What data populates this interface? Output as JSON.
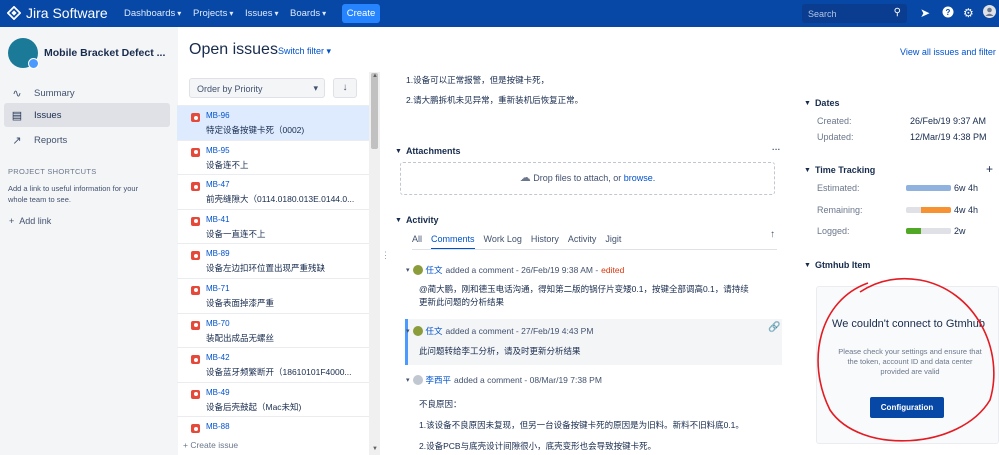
{
  "topbar": {
    "app_name": "Jira Software",
    "nav": [
      {
        "label": "Dashboards"
      },
      {
        "label": "Projects"
      },
      {
        "label": "Issues"
      },
      {
        "label": "Boards"
      }
    ],
    "create_label": "Create",
    "search_placeholder": "Search"
  },
  "sidebar": {
    "project_name": "Mobile Bracket Defect ...",
    "items": [
      {
        "label": "Summary",
        "icon": "pulse-icon"
      },
      {
        "label": "Issues",
        "icon": "issues-icon"
      },
      {
        "label": "Reports",
        "icon": "chart-icon"
      }
    ],
    "shortcuts_title": "PROJECT SHORTCUTS",
    "shortcuts_text": "Add a link to useful information for your whole team to see.",
    "add_link_label": "Add link"
  },
  "header": {
    "title": "Open issues",
    "switch_filter": "Switch filter",
    "view_all": "View all issues and filter"
  },
  "list": {
    "order_label": "Order by Priority",
    "issues": [
      {
        "key": "MB-96",
        "summary": "特定设备按键卡死（0002)"
      },
      {
        "key": "MB-95",
        "summary": "设备连不上"
      },
      {
        "key": "MB-47",
        "summary": "前壳缝隙大（0114.0180.013E.0144.0..."
      },
      {
        "key": "MB-41",
        "summary": "设备一直连不上"
      },
      {
        "key": "MB-89",
        "summary": "设备左边扣环位置出现严重残缺"
      },
      {
        "key": "MB-71",
        "summary": "设备表面掉漆严重"
      },
      {
        "key": "MB-70",
        "summary": "装配出成品无螺丝"
      },
      {
        "key": "MB-42",
        "summary": "设备蓝牙频繁断开（18610101F4000..."
      },
      {
        "key": "MB-49",
        "summary": "设备后壳鼓起（Mac未知)"
      },
      {
        "key": "MB-88",
        "summary": ""
      }
    ],
    "create_issue": "+ Create issue"
  },
  "detail": {
    "desc_lines": [
      "1.设备可以正常报警，但是按键卡死，",
      "2.请大鹏拆机未见异常，重新装机后恢复正常。"
    ],
    "attachments_title": "Attachments",
    "drop_text": "Drop files to attach, or ",
    "browse_text": "browse.",
    "activity_title": "Activity",
    "tabs": [
      "All",
      "Comments",
      "Work Log",
      "History",
      "Activity",
      "Jigit"
    ],
    "comments": [
      {
        "author": "任文",
        "meta": "added a comment - 26/Feb/19 9:38 AM - ",
        "edited": "edited",
        "lines": [
          "@蔺大鹏，刚和德玉电话沟通，得知第二版的锅仔片变矮0.1，按键全部调高0.1，请持续",
          "更新此问题的分析结果"
        ]
      },
      {
        "author": "任文",
        "meta": "added a comment - 27/Feb/19 4:43 PM",
        "edited": "",
        "lines": [
          "此问题转给李工分析，请及时更新分析结果"
        ]
      },
      {
        "author": "李西平",
        "meta": "added a comment - 08/Mar/19 7:38 PM",
        "edited": "",
        "lines": [
          "不良原因：",
          "1.该设备不良原因未复现，但另一台设备按键卡死的原因是为旧料。新料不旧料底0.1。",
          "2.设备PCB与底壳设计间隙很小，底壳变形也会导致按键卡死。"
        ]
      }
    ]
  },
  "right": {
    "dates_title": "Dates",
    "created_label": "Created:",
    "created_value": "26/Feb/19 9:37 AM",
    "updated_label": "Updated:",
    "updated_value": "12/Mar/19 4:38 PM",
    "time_title": "Time Tracking",
    "estimated_label": "Estimated:",
    "estimated_value": "6w 4h",
    "remaining_label": "Remaining:",
    "remaining_value": "4w 4h",
    "logged_label": "Logged:",
    "logged_value": "2w",
    "estimated_fraction": 1.0,
    "remaining_fraction": 0.66,
    "logged_fraction": 0.34,
    "gtmhub_title": "Gtmhub Item",
    "gtmhub_heading": "We couldn't connect to Gtmhub",
    "gtmhub_text": "Please check your settings and ensure that the token, account ID and data center provided are valid",
    "gtmhub_button": "Configuration"
  },
  "colors": {
    "topbar": "#0747a6",
    "accent": "#0052cc",
    "estimated_bar": "#8fb3de",
    "remaining_bar": "#f79232",
    "logged_bar": "#51a825",
    "annotation": "#e31b23"
  }
}
